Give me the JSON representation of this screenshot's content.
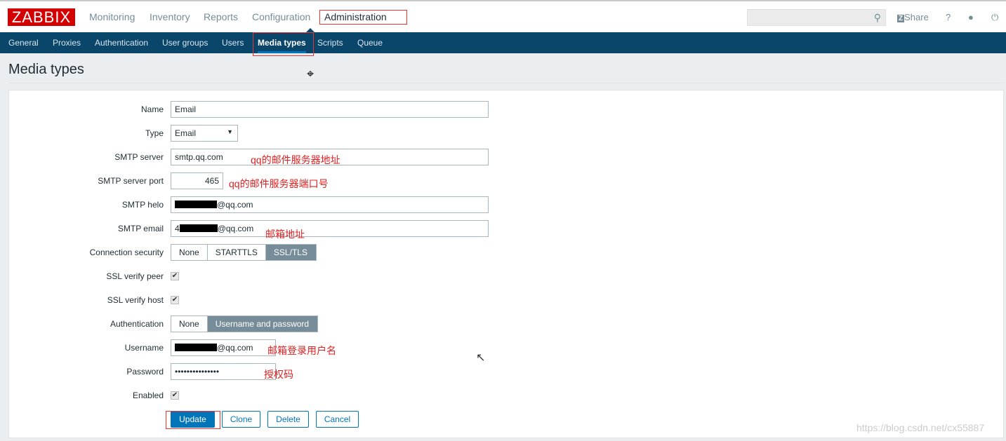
{
  "header": {
    "logo": "ZABBIX",
    "menu": [
      "Monitoring",
      "Inventory",
      "Reports",
      "Configuration",
      "Administration"
    ],
    "active_menu": "Administration",
    "search_placeholder": "",
    "share": "Share",
    "help": "?"
  },
  "subnav": {
    "items": [
      "General",
      "Proxies",
      "Authentication",
      "User groups",
      "Users",
      "Media types",
      "Scripts",
      "Queue"
    ],
    "active": "Media types"
  },
  "page_title": "Media types",
  "form": {
    "name": {
      "label": "Name",
      "value": "Email"
    },
    "type": {
      "label": "Type",
      "value": "Email"
    },
    "smtp_server": {
      "label": "SMTP server",
      "value": "smtp.qq.com",
      "note": "qq的邮件服务器地址"
    },
    "smtp_port": {
      "label": "SMTP server port",
      "value": "465",
      "note": "qq的邮件服务器端口号"
    },
    "smtp_helo": {
      "label": "SMTP helo",
      "value": "@qq.com"
    },
    "smtp_email": {
      "label": "SMTP email",
      "value_prefix": "4",
      "value": "@qq.com",
      "note": "邮箱地址"
    },
    "connection_security": {
      "label": "Connection security",
      "options": [
        "None",
        "STARTTLS",
        "SSL/TLS"
      ],
      "selected": "SSL/TLS"
    },
    "ssl_verify_peer": {
      "label": "SSL verify peer",
      "checked": true
    },
    "ssl_verify_host": {
      "label": "SSL verify host",
      "checked": true
    },
    "authentication": {
      "label": "Authentication",
      "options": [
        "None",
        "Username and password"
      ],
      "selected": "Username and password"
    },
    "username": {
      "label": "Username",
      "value": "@qq.com",
      "note": "邮箱登录用户名"
    },
    "password": {
      "label": "Password",
      "value": "•••••••••••••••",
      "note": "授权码"
    },
    "enabled": {
      "label": "Enabled",
      "checked": true
    }
  },
  "buttons": {
    "update": "Update",
    "clone": "Clone",
    "delete": "Delete",
    "cancel": "Cancel"
  },
  "watermark": "https://blog.csdn.net/cx55887",
  "colors": {
    "brand": "#d40000",
    "nav": "#0a466a",
    "accent": "#0275b8",
    "annotation": "#e02020"
  }
}
